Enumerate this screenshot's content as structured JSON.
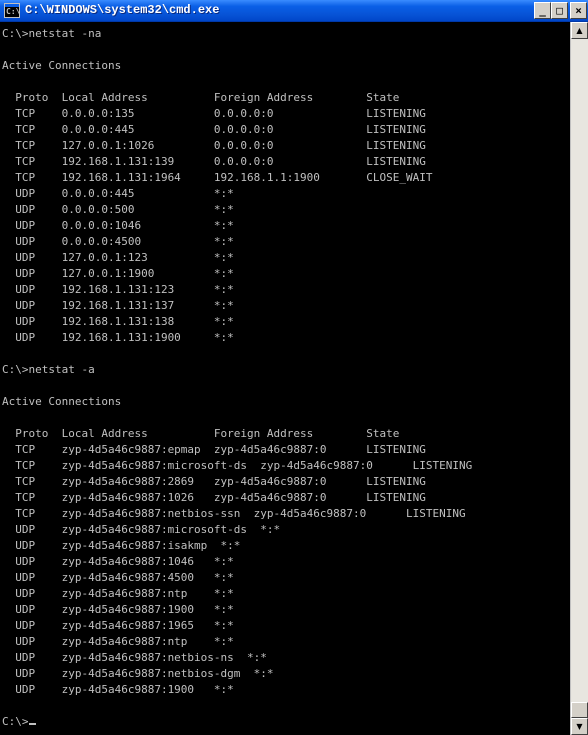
{
  "window": {
    "title": "C:\\WINDOWS\\system32\\cmd.exe",
    "minimize_glyph": "_",
    "maximize_glyph": "□",
    "close_glyph": "×",
    "icon": "console-icon"
  },
  "console": {
    "lines": [
      "C:\\>netstat -na",
      "",
      "Active Connections",
      "",
      "  Proto  Local Address          Foreign Address        State",
      "  TCP    0.0.0.0:135            0.0.0.0:0              LISTENING",
      "  TCP    0.0.0.0:445            0.0.0.0:0              LISTENING",
      "  TCP    127.0.0.1:1026         0.0.0.0:0              LISTENING",
      "  TCP    192.168.1.131:139      0.0.0.0:0              LISTENING",
      "  TCP    192.168.1.131:1964     192.168.1.1:1900       CLOSE_WAIT",
      "  UDP    0.0.0.0:445            *:*",
      "  UDP    0.0.0.0:500            *:*",
      "  UDP    0.0.0.0:1046           *:*",
      "  UDP    0.0.0.0:4500           *:*",
      "  UDP    127.0.0.1:123          *:*",
      "  UDP    127.0.0.1:1900         *:*",
      "  UDP    192.168.1.131:123      *:*",
      "  UDP    192.168.1.131:137      *:*",
      "  UDP    192.168.1.131:138      *:*",
      "  UDP    192.168.1.131:1900     *:*",
      "",
      "C:\\>netstat -a",
      "",
      "Active Connections",
      "",
      "  Proto  Local Address          Foreign Address        State",
      "  TCP    zyp-4d5a46c9887:epmap  zyp-4d5a46c9887:0      LISTENING",
      "  TCP    zyp-4d5a46c9887:microsoft-ds  zyp-4d5a46c9887:0      LISTENING",
      "  TCP    zyp-4d5a46c9887:2869   zyp-4d5a46c9887:0      LISTENING",
      "  TCP    zyp-4d5a46c9887:1026   zyp-4d5a46c9887:0      LISTENING",
      "  TCP    zyp-4d5a46c9887:netbios-ssn  zyp-4d5a46c9887:0      LISTENING",
      "  UDP    zyp-4d5a46c9887:microsoft-ds  *:*",
      "  UDP    zyp-4d5a46c9887:isakmp  *:*",
      "  UDP    zyp-4d5a46c9887:1046   *:*",
      "  UDP    zyp-4d5a46c9887:4500   *:*",
      "  UDP    zyp-4d5a46c9887:ntp    *:*",
      "  UDP    zyp-4d5a46c9887:1900   *:*",
      "  UDP    zyp-4d5a46c9887:1965   *:*",
      "  UDP    zyp-4d5a46c9887:ntp    *:*",
      "  UDP    zyp-4d5a46c9887:netbios-ns  *:*",
      "  UDP    zyp-4d5a46c9887:netbios-dgm  *:*",
      "  UDP    zyp-4d5a46c9887:1900   *:*",
      ""
    ],
    "prompt": "C:\\>"
  },
  "colors": {
    "console_bg": "#000000",
    "console_fg": "#c0c0c0",
    "titlebar": "#0a5fe6"
  }
}
